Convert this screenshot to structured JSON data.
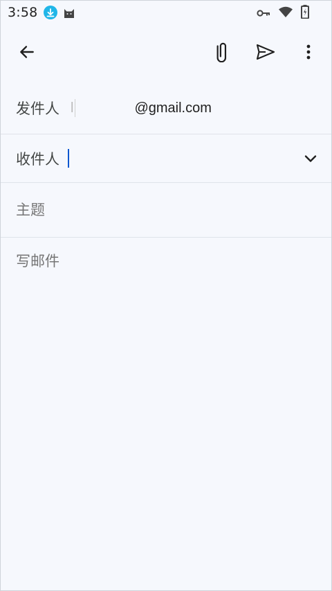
{
  "status_bar": {
    "time": "3:58",
    "left_icons": [
      "download-icon",
      "cat-icon"
    ],
    "right_icons": [
      "vpn-key-icon",
      "wifi-icon",
      "battery-icon"
    ]
  },
  "toolbar": {
    "icons": [
      "back-arrow-icon",
      "paperclip-icon",
      "send-icon",
      "more-vert-icon"
    ]
  },
  "from": {
    "label": "发件人",
    "email_prefix": "l",
    "email_suffix": "@gmail.com"
  },
  "to": {
    "label": "收件人"
  },
  "subject": {
    "placeholder": "主题"
  },
  "body": {
    "placeholder": "写邮件"
  },
  "colors": {
    "background": "#f6f8fd",
    "accent": "#0b57d0",
    "download_badge": "#20b6e8"
  }
}
